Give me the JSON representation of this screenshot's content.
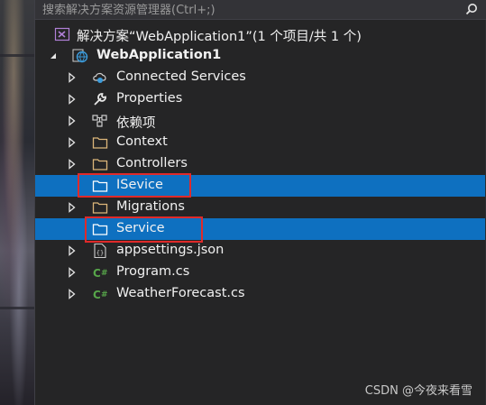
{
  "search": {
    "placeholder": "搜索解决方案资源管理器(Ctrl+;)"
  },
  "solution": {
    "label": "解决方案“WebApplication1”(1 个项目/共 1 个)"
  },
  "project": {
    "label": "WebApplication1"
  },
  "items": [
    {
      "label": "Connected Services",
      "icon": "connected-services-icon"
    },
    {
      "label": "Properties",
      "icon": "wrench-icon"
    },
    {
      "label": "依赖项",
      "icon": "dependencies-icon"
    },
    {
      "label": "Context",
      "icon": "folder-icon"
    },
    {
      "label": "Controllers",
      "icon": "folder-icon"
    },
    {
      "label": "ISevice",
      "icon": "folder-icon",
      "selected": true
    },
    {
      "label": "Migrations",
      "icon": "folder-icon"
    },
    {
      "label": "Service",
      "icon": "folder-icon",
      "selected": true
    },
    {
      "label": "appsettings.json",
      "icon": "json-file-icon"
    },
    {
      "label": "Program.cs",
      "icon": "csharp-file-icon"
    },
    {
      "label": "WeatherForecast.cs",
      "icon": "csharp-file-icon"
    }
  ],
  "watermark": "CSDN @今夜来看雪",
  "colors": {
    "selection": "#0e70c0",
    "highlight_box": "#e02a2a",
    "background": "#252526"
  }
}
